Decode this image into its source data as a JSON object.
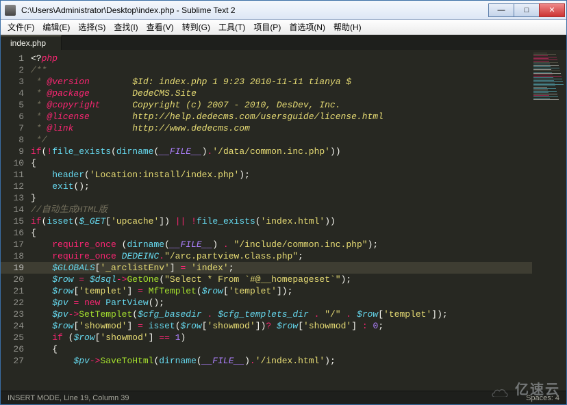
{
  "window": {
    "title": "C:\\Users\\Administrator\\Desktop\\index.php - Sublime Text 2"
  },
  "menu": {
    "file": "文件(F)",
    "edit": "编辑(E)",
    "select": "选择(S)",
    "find": "查找(I)",
    "view": "查看(V)",
    "goto": "转到(G)",
    "tools": "工具(T)",
    "project": "项目(P)",
    "prefs": "首选项(N)",
    "help": "帮助(H)"
  },
  "tab": {
    "name": "index.php"
  },
  "code": {
    "lines": [
      {
        "n": 1,
        "html": "<span class='c-punc'>&lt;?</span><span class='c-keyword'>php</span>"
      },
      {
        "n": 2,
        "html": "<span class='c-comment'>/**</span>"
      },
      {
        "n": 3,
        "html": "<span class='c-comment'> * </span><span class='c-doctag'>@version</span><span class='c-comment'>        </span><span class='c-docstr'>$Id: index.php 1 9:23 2010-11-11 tianya $</span>"
      },
      {
        "n": 4,
        "html": "<span class='c-comment'> * </span><span class='c-doctag'>@package</span><span class='c-comment'>        </span><span class='c-docstr'>DedeCMS.Site</span>"
      },
      {
        "n": 5,
        "html": "<span class='c-comment'> * </span><span class='c-doctag'>@copyright</span><span class='c-comment'>      </span><span class='c-docstr'>Copyright (c) 2007 - 2010, DesDev, Inc.</span>"
      },
      {
        "n": 6,
        "html": "<span class='c-comment'> * </span><span class='c-doctag'>@license</span><span class='c-comment'>        </span><span class='c-docstr'>http://help.dedecms.com/usersguide/license.html</span>"
      },
      {
        "n": 7,
        "html": "<span class='c-comment'> * </span><span class='c-doctag'>@link</span><span class='c-comment'>           </span><span class='c-docstr'>http://www.dedecms.com</span>"
      },
      {
        "n": 8,
        "html": "<span class='c-comment'> */</span>"
      },
      {
        "n": 9,
        "html": "<span class='c-tag'>if</span>(<span class='c-tag'>!</span><span class='c-func'>file_exists</span>(<span class='c-func'>dirname</span>(<span class='c-const'>__FILE__</span>)<span class='c-tag'>.</span><span class='c-str'>'/data/common.inc.php'</span>))"
      },
      {
        "n": 10,
        "html": "{"
      },
      {
        "n": 11,
        "html": "    <span class='c-func'>header</span>(<span class='c-str'>'Location:install/index.php'</span>);"
      },
      {
        "n": 12,
        "html": "    <span class='c-func'>exit</span>();"
      },
      {
        "n": 13,
        "html": "}"
      },
      {
        "n": 14,
        "html": "<span class='c-comment'>//自动生成HTML版</span>"
      },
      {
        "n": 15,
        "html": "<span class='c-tag'>if</span>(<span class='c-func'>isset</span>(<span class='c-var'>$_GET</span>[<span class='c-str'>'upcache'</span>]) <span class='c-tag'>||</span> <span class='c-tag'>!</span><span class='c-func'>file_exists</span>(<span class='c-str'>'index.html'</span>))"
      },
      {
        "n": 16,
        "html": "{"
      },
      {
        "n": 17,
        "html": "    <span class='c-tag'>require_once</span> (<span class='c-func'>dirname</span>(<span class='c-const'>__FILE__</span>) <span class='c-tag'>.</span> <span class='c-str'>\"/include/common.inc.php\"</span>);"
      },
      {
        "n": 18,
        "html": "    <span class='c-tag'>require_once</span> <span class='c-var'>DEDEINC</span><span class='c-tag'>.</span><span class='c-str'>\"/arc.partview.class.php\"</span>;"
      },
      {
        "n": 19,
        "html": "    <span class='c-var'>$GLOBALS</span>[<span class='c-str'>'_arclistEnv'</span>] <span class='c-tag'>=</span> <span class='c-str'>'index'</span>;",
        "current": true
      },
      {
        "n": 20,
        "html": "    <span class='c-var'>$row</span> <span class='c-tag'>=</span> <span class='c-var'>$dsql</span><span class='c-tag'>-></span><span class='c-call'>GetOne</span>(<span class='c-str'>\"Select * From `#@__homepageset`\"</span>);"
      },
      {
        "n": 21,
        "html": "    <span class='c-var'>$row</span>[<span class='c-str'>'templet'</span>] <span class='c-tag'>=</span> <span class='c-call'>MfTemplet</span>(<span class='c-var'>$row</span>[<span class='c-str'>'templet'</span>]);"
      },
      {
        "n": 22,
        "html": "    <span class='c-var'>$pv</span> <span class='c-tag'>=</span> <span class='c-tag'>new</span> <span class='c-func'>PartView</span>();"
      },
      {
        "n": 23,
        "html": "    <span class='c-var'>$pv</span><span class='c-tag'>-></span><span class='c-call'>SetTemplet</span>(<span class='c-var'>$cfg_basedir</span> <span class='c-tag'>.</span> <span class='c-var'>$cfg_templets_dir</span> <span class='c-tag'>.</span> <span class='c-str'>\"/\"</span> <span class='c-tag'>.</span> <span class='c-var'>$row</span>[<span class='c-str'>'templet'</span>]);"
      },
      {
        "n": 24,
        "html": "    <span class='c-var'>$row</span>[<span class='c-str'>'showmod'</span>] <span class='c-tag'>=</span> <span class='c-func'>isset</span>(<span class='c-var'>$row</span>[<span class='c-str'>'showmod'</span>])<span class='c-tag'>?</span> <span class='c-var'>$row</span>[<span class='c-str'>'showmod'</span>] <span class='c-tag'>:</span> <span class='c-num'>0</span>;"
      },
      {
        "n": 25,
        "html": "    <span class='c-tag'>if</span> (<span class='c-var'>$row</span>[<span class='c-str'>'showmod'</span>] <span class='c-tag'>==</span> <span class='c-num'>1</span>)"
      },
      {
        "n": 26,
        "html": "    {"
      },
      {
        "n": 27,
        "html": "        <span class='c-var'>$pv</span><span class='c-tag'>-></span><span class='c-call'>SaveToHtml</span>(<span class='c-func'>dirname</span>(<span class='c-const'>__FILE__</span>)<span class='c-tag'>.</span><span class='c-str'>'/index.html'</span>);"
      }
    ]
  },
  "status": {
    "left": "INSERT MODE, Line 19, Column 39",
    "right": "Spaces: 4"
  },
  "watermark": "亿速云",
  "minimap_colors": [
    "#75715e",
    "#75715e",
    "#f92672",
    "#f92672",
    "#f92672",
    "#f92672",
    "#f92672",
    "#75715e",
    "#66d9ef",
    "#f8f8f2",
    "#66d9ef",
    "#66d9ef",
    "#f8f8f2",
    "#75715e",
    "#66d9ef",
    "#f8f8f2",
    "#f92672",
    "#f92672",
    "#66d9ef",
    "#66d9ef",
    "#66d9ef",
    "#66d9ef",
    "#66d9ef",
    "#66d9ef",
    "#66d9ef",
    "#f8f8f2",
    "#66d9ef",
    "#f8f8f2",
    "#66d9ef",
    "#66d9ef",
    "#f8f8f2",
    "#f92672",
    "#66d9ef",
    "#66d9ef",
    "#f8f8f2"
  ]
}
